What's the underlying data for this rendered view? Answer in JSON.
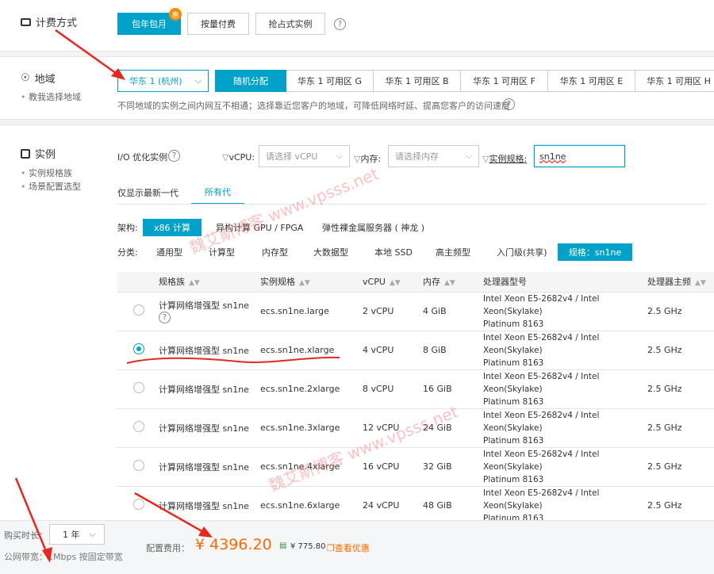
{
  "billing": {
    "title": "计费方式",
    "options": [
      "包年包月",
      "按量付费",
      "抢占式实例"
    ],
    "badge": "惠"
  },
  "region": {
    "title": "地域",
    "sub_links": [
      "教我选择地域"
    ],
    "selected_region": "华东 1 (杭州)",
    "zones": [
      "随机分配",
      "华东 1 可用区 G",
      "华东 1 可用区 B",
      "华东 1 可用区 F",
      "华东 1 可用区 E",
      "华东 1 可用区 H"
    ],
    "note": "不同地域的实例之间内网互不相通；选择靠近您客户的地域，可降低网络时延、提高您客户的访问速度"
  },
  "instance": {
    "title": "实例",
    "sub_links": [
      "实例规格族",
      "场景配置选型"
    ],
    "io_label": "I/O 优化实例",
    "vcpu_label": "vCPU:",
    "vcpu_placeholder": "请选择 vCPU",
    "mem_label": "内存:",
    "mem_placeholder": "请选择内存",
    "spec_label": "实例规格:",
    "spec_value": "sn1ne",
    "tabs": [
      "仅显示最新一代",
      "所有代"
    ],
    "arch_label": "架构:",
    "arch_options": [
      "x86 计算",
      "异构计算 GPU / FPGA",
      "弹性裸金属服务器 ( 神龙 )"
    ],
    "cat_label": "分类:",
    "cat_options": [
      "通用型",
      "计算型",
      "内存型",
      "大数据型",
      "本地 SSD",
      "高主频型",
      "入门级(共享)",
      "规格：sn1ne"
    ],
    "columns": [
      "规格族",
      "实例规格",
      "vCPU",
      "内存",
      "处理器型号",
      "处理器主频"
    ],
    "rows": [
      {
        "family": "计算网络增强型 sn1ne",
        "spec": "ecs.sn1ne.large",
        "vcpu": "2 vCPU",
        "mem": "4 GiB",
        "proc1": "Intel Xeon E5-2682v4 / Intel Xeon(Skylake)",
        "proc2": "Platinum 8163",
        "freq": "2.5 GHz"
      },
      {
        "family": "计算网络增强型 sn1ne",
        "spec": "ecs.sn1ne.xlarge",
        "vcpu": "4 vCPU",
        "mem": "8 GiB",
        "proc1": "Intel Xeon E5-2682v4 / Intel Xeon(Skylake)",
        "proc2": "Platinum 8163",
        "freq": "2.5 GHz"
      },
      {
        "family": "计算网络增强型 sn1ne",
        "spec": "ecs.sn1ne.2xlarge",
        "vcpu": "8 vCPU",
        "mem": "16 GiB",
        "proc1": "Intel Xeon E5-2682v4 / Intel Xeon(Skylake)",
        "proc2": "Platinum 8163",
        "freq": "2.5 GHz"
      },
      {
        "family": "计算网络增强型 sn1ne",
        "spec": "ecs.sn1ne.3xlarge",
        "vcpu": "12 vCPU",
        "mem": "24 GiB",
        "proc1": "Intel Xeon E5-2682v4 / Intel Xeon(Skylake)",
        "proc2": "Platinum 8163",
        "freq": "2.5 GHz"
      },
      {
        "family": "计算网络增强型 sn1ne",
        "spec": "ecs.sn1ne.4xlarge",
        "vcpu": "16 vCPU",
        "mem": "32 GiB",
        "proc1": "Intel Xeon E5-2682v4 / Intel Xeon(Skylake)",
        "proc2": "Platinum 8163",
        "freq": "2.5 GHz"
      },
      {
        "family": "计算网络增强型 sn1ne",
        "spec": "ecs.sn1ne.6xlarge",
        "vcpu": "24 vCPU",
        "mem": "48 GiB",
        "proc1": "Intel Xeon E5-2682v4 / Intel Xeon(Skylake)",
        "proc2": "Platinum 8163",
        "freq": "2.5 GHz"
      }
    ],
    "selected_row": 1
  },
  "footer": {
    "duration_label": "购买时长：",
    "duration_value": "1 年",
    "bandwidth": "公网带宽：1Mbps 按固定带宽",
    "cost_label": "配置费用：",
    "price": "¥ 4396.20",
    "discount": "¥ 775.80",
    "discount_link": "查看优惠"
  },
  "watermark": "魏艾斯博客 www.vpsss.net",
  "colors": {
    "accent": "#00a2ca",
    "price": "#ff6a00",
    "annotation": "#e8281e"
  }
}
